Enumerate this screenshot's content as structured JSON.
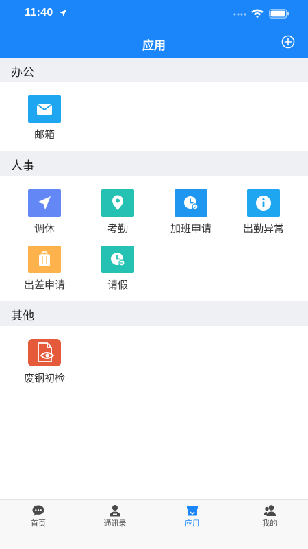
{
  "status_bar": {
    "time": "11:40"
  },
  "header": {
    "title": "应用",
    "add_icon": "plus-circle-icon"
  },
  "sections": [
    {
      "title": "办公",
      "apps": [
        {
          "label": "邮箱",
          "icon": "mail-icon",
          "color": "#1fa6f1"
        }
      ]
    },
    {
      "title": "人事",
      "apps": [
        {
          "label": "调休",
          "icon": "navigation-arrow-icon",
          "color": "#6388f6"
        },
        {
          "label": "考勤",
          "icon": "location-pin-icon",
          "color": "#25c2b4"
        },
        {
          "label": "加班申请",
          "icon": "clock-icon",
          "color": "#1f97f0"
        },
        {
          "label": "出勤异常",
          "icon": "info-icon",
          "color": "#1fa6f1"
        },
        {
          "label": "出差申请",
          "icon": "suitcase-icon",
          "color": "#fdb24b"
        },
        {
          "label": "请假",
          "icon": "clock-icon",
          "color": "#25c2b4"
        }
      ]
    },
    {
      "title": "其他",
      "apps": [
        {
          "label": "废钢初检",
          "icon": "document-eye-icon",
          "color": "#e65a3c"
        }
      ]
    }
  ],
  "tabbar": {
    "items": [
      {
        "label": "首页",
        "icon": "chat-bubble-icon"
      },
      {
        "label": "通讯录",
        "icon": "contact-person-icon"
      },
      {
        "label": "应用",
        "icon": "app-store-icon"
      },
      {
        "label": "我的",
        "icon": "users-icon"
      }
    ],
    "active_index": 2
  },
  "colors": {
    "primary": "#1a86fa",
    "section_bg": "#eff0f4"
  }
}
